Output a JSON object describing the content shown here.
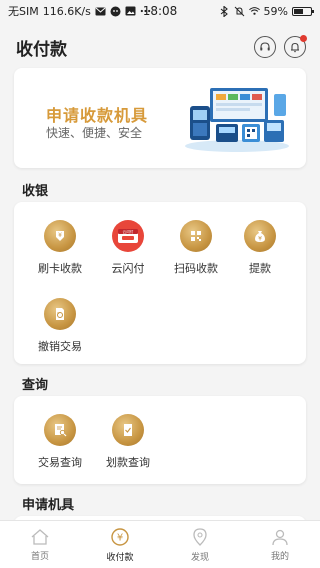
{
  "status_bar": {
    "carrier": "无SIM",
    "speed": "116.6K/s",
    "time": "18:08",
    "battery_percent": "59%",
    "battery_level": 0.59,
    "icons": [
      "mail-icon",
      "wechat-icon",
      "image-icon",
      "more-dots-icon",
      "bluetooth-icon",
      "mute-bell-icon",
      "wifi-icon",
      "battery-icon"
    ]
  },
  "header": {
    "title": "收付款",
    "actions": [
      "headset-icon",
      "bell-icon"
    ]
  },
  "banner": {
    "title": "申请收款机具",
    "subtitle": "快速、便捷、安全"
  },
  "sections": {
    "cashier": {
      "title": "收银",
      "items": [
        {
          "label": "刷卡收款",
          "icon": "card-swipe-icon"
        },
        {
          "label": "云闪付",
          "icon": "cloud-quickpass-icon",
          "badge": "云闪付"
        },
        {
          "label": "扫码收款",
          "icon": "qr-scan-icon"
        },
        {
          "label": "提款",
          "icon": "money-bag-icon"
        },
        {
          "label": "撤销交易",
          "icon": "revoke-document-icon"
        }
      ]
    },
    "query": {
      "title": "查询",
      "items": [
        {
          "label": "交易查询",
          "icon": "transaction-search-icon"
        },
        {
          "label": "划款查询",
          "icon": "transfer-check-icon"
        }
      ]
    },
    "apply": {
      "title": "申请机具"
    }
  },
  "tabbar": {
    "items": [
      {
        "label": "首页",
        "icon": "home-icon",
        "active": false
      },
      {
        "label": "收付款",
        "icon": "yuan-coin-icon",
        "active": true
      },
      {
        "label": "发现",
        "icon": "discover-icon",
        "active": false
      },
      {
        "label": "我的",
        "icon": "user-icon",
        "active": false
      }
    ]
  },
  "colors": {
    "accent_gold": "#c79542",
    "banner_title": "#d79a3a",
    "badge_red": "#e03a2f",
    "quickpass_red": "#e8463a"
  }
}
